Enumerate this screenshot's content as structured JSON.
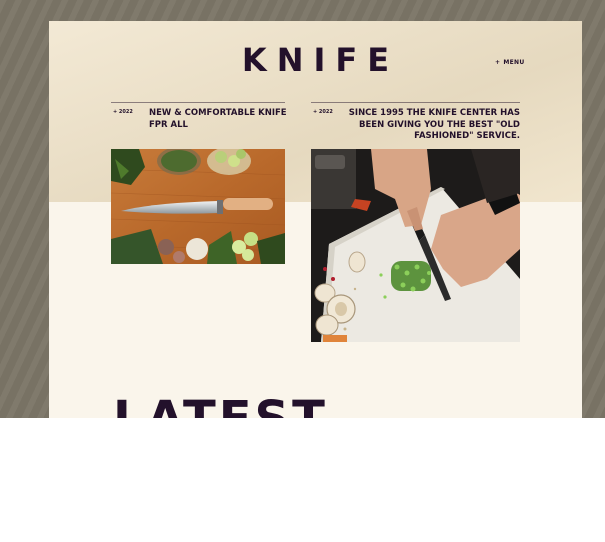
{
  "header": {
    "logo": "KNIFE",
    "menu_bullet": "+",
    "menu_label": "MENU"
  },
  "cards": [
    {
      "year": "+ 2022",
      "title": "NEW & COMFORTABLE KNIFE FPR ALL",
      "image": "knife-on-cutting-board-photo"
    },
    {
      "year": "+ 2022",
      "title": "SINCE 1995 THE KNIFE CENTER HAS BEEN GIVING YOU THE BEST \"OLD FASHIONED\" SERVICE.",
      "image": "chopping-herbs-photo"
    }
  ],
  "section": {
    "heading": "LATEST"
  },
  "colors": {
    "backdrop": "#7c7667",
    "page_top": "#efe2c7",
    "page_bottom": "#faf5eb",
    "ink": "#23112b"
  }
}
